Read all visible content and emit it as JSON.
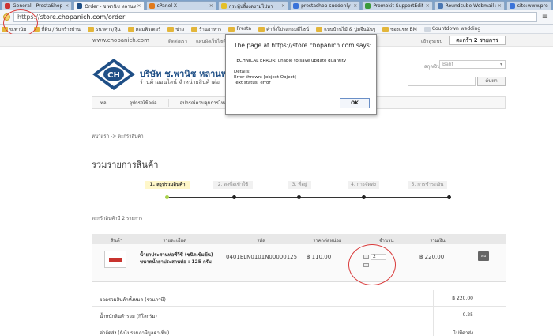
{
  "browser": {
    "tabs": [
      {
        "label": "General - PrestaShop™",
        "color": "#c33"
      },
      {
        "label": "Order - ช.พานิช หลานห",
        "color": "#1f4f86",
        "active": true
      },
      {
        "label": "cPanel X",
        "color": "#e07a1c"
      },
      {
        "label": "กระทู้ปลิ้งงดงามไปหา",
        "color": "#e4c02a"
      },
      {
        "label": "prestashop suddenly p",
        "color": "#3a73d9"
      },
      {
        "label": "Promokit SupportEdit",
        "color": "#3a9a3a"
      },
      {
        "label": "Roundcube Webmail ::",
        "color": "#4a77b3"
      },
      {
        "label": "site:www.pres",
        "color": "#3a73d9"
      }
    ],
    "tab_close": "×",
    "url_scheme": "https://",
    "url_host": "store.chopanich.com/order",
    "menu_icon": "≡",
    "bookmarks": [
      "ข.พานิช",
      "ที่ดิน / รับสร้างบ้าน",
      "ธนาคาร/หุ้น",
      "คอมพิวเตอร์",
      "ข่าว",
      "ร้านอาหาร",
      "Presta",
      "คำสั่งโปรแกรมดีไซน์",
      "แบบบ้านไม้ & ปูมจีนฉันๆ",
      "ช่องแชท BM",
      "Countdown wedding"
    ]
  },
  "page": {
    "site": "www.chopanich.com",
    "top_links": [
      "ติดต่อเรา",
      "แผนผังเว็บไซต์"
    ],
    "login": "เข้าสู่ระบบ",
    "cart_button": "ตะกร้า 2 รายการ",
    "logo_text": "CH",
    "brand": "บริษัท ช.พานิช หลานหลวง",
    "tagline": "ร้านค้าออนไลน์ จำหน่ายสินค้าต่อ",
    "currency_label": "สกุลเงิน",
    "currency_value": "Baht",
    "search_button": "ค้นหา",
    "menu": [
      "ท่อ",
      "อุปกรณ์ข้อต่อ",
      "อุปกรณ์ควบคุมการไหล"
    ],
    "breadcrumb": "หน้าแรก  ->  ตะกร้าสินค้า",
    "title": "รวมรายการสินค้า",
    "steps": [
      "1. สรุปรวมสินค้า",
      "2. ลงชื่อเข้าใช้",
      "3. ที่อยู่",
      "4. การจัดส่ง",
      "5. การชำระเงิน"
    ],
    "cart_count": "ตะกร้าสินค้ามี 2 รายการ",
    "columns": [
      "สินค้า",
      "รายละเอียด",
      "รหัส",
      "ราคาต่อหน่วย",
      "จำนวน",
      "รวมเงิน"
    ],
    "product": {
      "name": "น้ำยาประสานท่อพีวีซี (ชนิดเข้มข้น)",
      "size": "ขนาดน้ำยาประสานท่อ : 125 กรัม",
      "sku": "0401ELN0101N00000125",
      "unit_price": "฿ 110.00",
      "qty": "2",
      "total": "฿ 220.00",
      "delete": "ลบ"
    },
    "summary": [
      {
        "label": "ยอดรวมสินค้าทั้งหมด (รวมภาษี)",
        "value": "฿ 220.00"
      },
      {
        "label": "น้ำหนักสินค้ารวม (กิโลกรัม)",
        "value": "0.25"
      },
      {
        "label": "ค่าจัดส่ง (ยังไม่รวมภาษีมูลค่าเพิ่ม)",
        "value": "ไม่มีค่าส่ง"
      }
    ]
  },
  "dialog": {
    "title": "The page at https://store.chopanich.com says:",
    "body": "TECHNICAL ERROR: unable to save update quantity\n\nDetails:\nError thrown: [object Object]\nText status: error",
    "ok": "OK"
  },
  "colors": {
    "brand_blue": "#1f4f86",
    "step_active": "#a8d24a",
    "annotation_red": "#d93b3b"
  }
}
